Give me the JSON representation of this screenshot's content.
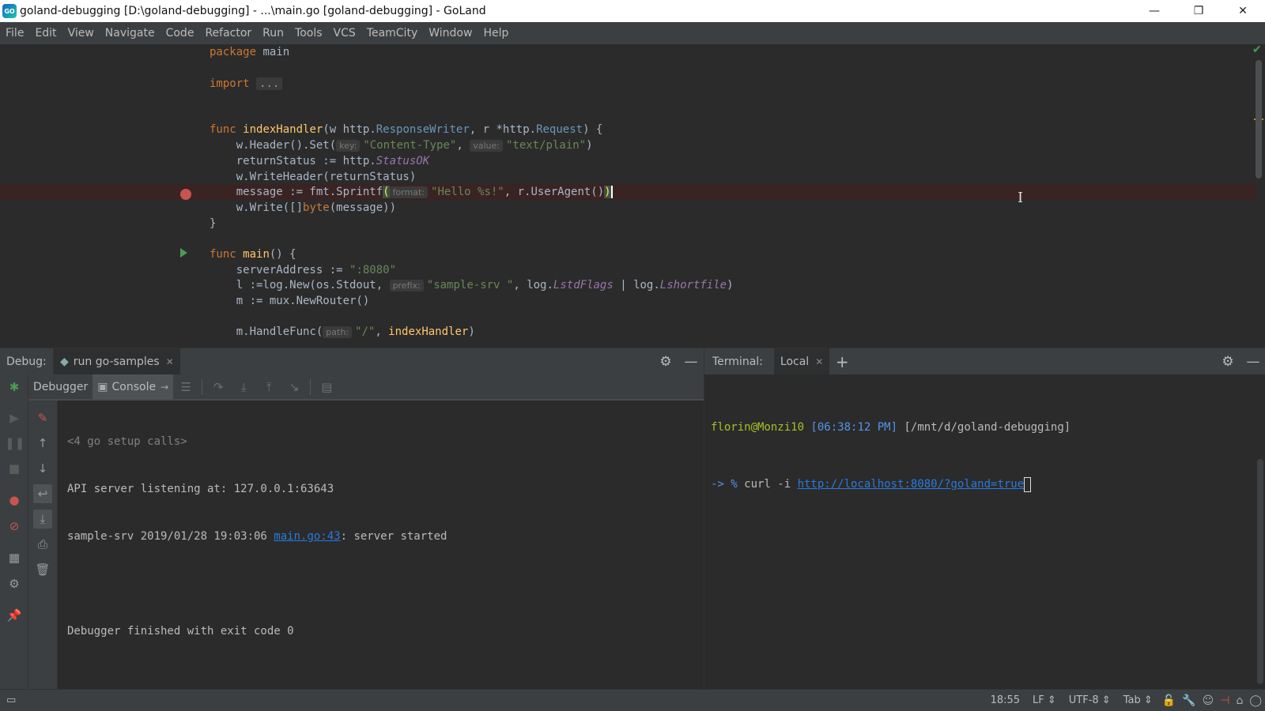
{
  "window": {
    "title": "goland-debugging [D:\\goland-debugging] - ...\\main.go [goland-debugging] - GoLand",
    "logo_text": "GO",
    "minimize": "—",
    "restore": "❐",
    "close": "✕"
  },
  "menu": [
    "File",
    "Edit",
    "View",
    "Navigate",
    "Code",
    "Refactor",
    "Run",
    "Tools",
    "VCS",
    "TeamCity",
    "Window",
    "Help"
  ],
  "editor": {
    "hints": {
      "key": "key:",
      "value": "value:",
      "format": "format:",
      "prefix": "prefix:",
      "path": "path:"
    },
    "fold_text": "...",
    "tokens": {
      "package": "package",
      "main_pkg": "main",
      "import": "import",
      "func": "func",
      "indexHandler": "indexHandler",
      "handler_params_a": "(w http.",
      "response_writer": "ResponseWriter",
      "handler_params_b": ", r *http.",
      "request": "Request",
      "handler_params_c": ") {",
      "header_set": "    w.Header().Set(",
      "content_type": "\"Content-Type\"",
      "comma_space": ", ",
      "text_plain": "\"text/plain\"",
      "close_paren": ")",
      "return_status": "    returnStatus := http.",
      "status_ok": "StatusOK",
      "write_header": "    w.WriteHeader(returnStatus)",
      "message_sprintf": "    message := fmt.Sprintf",
      "open_paren": "(",
      "hello_str": "\"Hello %s!\"",
      "user_agent": ", r.UserAgent()",
      "write_bytes_a": "    w.Write([]",
      "byte_kw": "byte",
      "write_bytes_b": "(message))",
      "close_brace": "}",
      "main_fn": "main",
      "main_params": "() {",
      "server_address": "    serverAddress := ",
      "port_str": "\":8080\"",
      "log_new": "    l :=log.New(os.Stdout, ",
      "sample_srv_str": "\"sample-srv \"",
      "log_flags_a": ", log.",
      "lstd_flags": "LstdFlags",
      "log_flags_b": " | log.",
      "lshortfile": "Lshortfile",
      "new_router": "    m := mux.NewRouter()",
      "handle_func": "    m.HandleFunc(",
      "slash_str": "\"/\"",
      "index_handler_ref": "indexHandler"
    }
  },
  "debug": {
    "panel_title": "Debug:",
    "run_tab": "run go-samples",
    "debugger_tab": "Debugger",
    "console_tab": "Console",
    "console_lines": {
      "setup_calls": "<4 go setup calls>",
      "api_listening": "API server listening at: 127.0.0.1:63643",
      "server_prefix": "sample-srv 2019/01/28 19:03:06 ",
      "server_link": "main.go:43",
      "server_suffix": ": server started",
      "finished": "Debugger finished with exit code 0"
    }
  },
  "terminal": {
    "panel_title": "Terminal:",
    "local_tab": "Local",
    "prompt_user": "florin@Monzi10",
    "prompt_time": "[06:38:12 PM]",
    "prompt_path": "[/mnt/d/goland-debugging]",
    "arrow": "-> %",
    "command": " curl -i ",
    "url": "http://localhost:8080/?goland=true"
  },
  "statusbar": {
    "position": "18:55",
    "line_sep": "LF ⇕",
    "encoding": "UTF-8 ⇕",
    "indent": "Tab ⇕"
  },
  "colors": {
    "editor_bg": "#2b2b2b",
    "panel_bg": "#3c3f41",
    "breakpoint": "#c75450",
    "keyword": "#cc7832",
    "function": "#ffc66d",
    "string": "#6a8759",
    "link": "#287bde"
  }
}
